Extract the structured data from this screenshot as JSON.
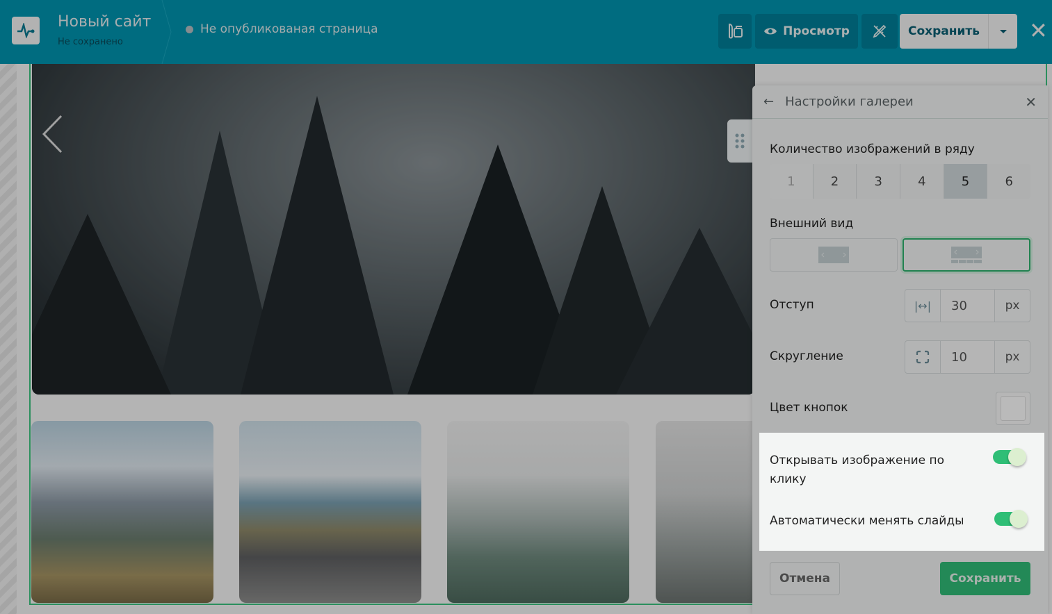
{
  "header": {
    "site_title": "Новый сайт",
    "site_status": "Не сохранено",
    "page_status": "Не опубликованая страница",
    "preview_label": "Просмотр",
    "save_label": "Сохранить"
  },
  "panel": {
    "title": "Настройки галереи",
    "count_label": "Количество изображений в ряду",
    "count_options": [
      "1",
      "2",
      "3",
      "4",
      "5",
      "6"
    ],
    "count_selected": "5",
    "view_label": "Внешний вид",
    "padding_label": "Отступ",
    "padding_value": "30",
    "padding_unit": "px",
    "radius_label": "Скругление",
    "radius_value": "10",
    "radius_unit": "px",
    "button_color_label": "Цвет кнопок",
    "open_on_click_label": "Открывать изображение по клику",
    "open_on_click": true,
    "autoplay_label": "Автоматически менять слайды",
    "autoplay": true,
    "cancel_label": "Отмена",
    "save_label": "Сохранить"
  },
  "colors": {
    "header": "#0095b0",
    "accent": "#30bc78"
  }
}
